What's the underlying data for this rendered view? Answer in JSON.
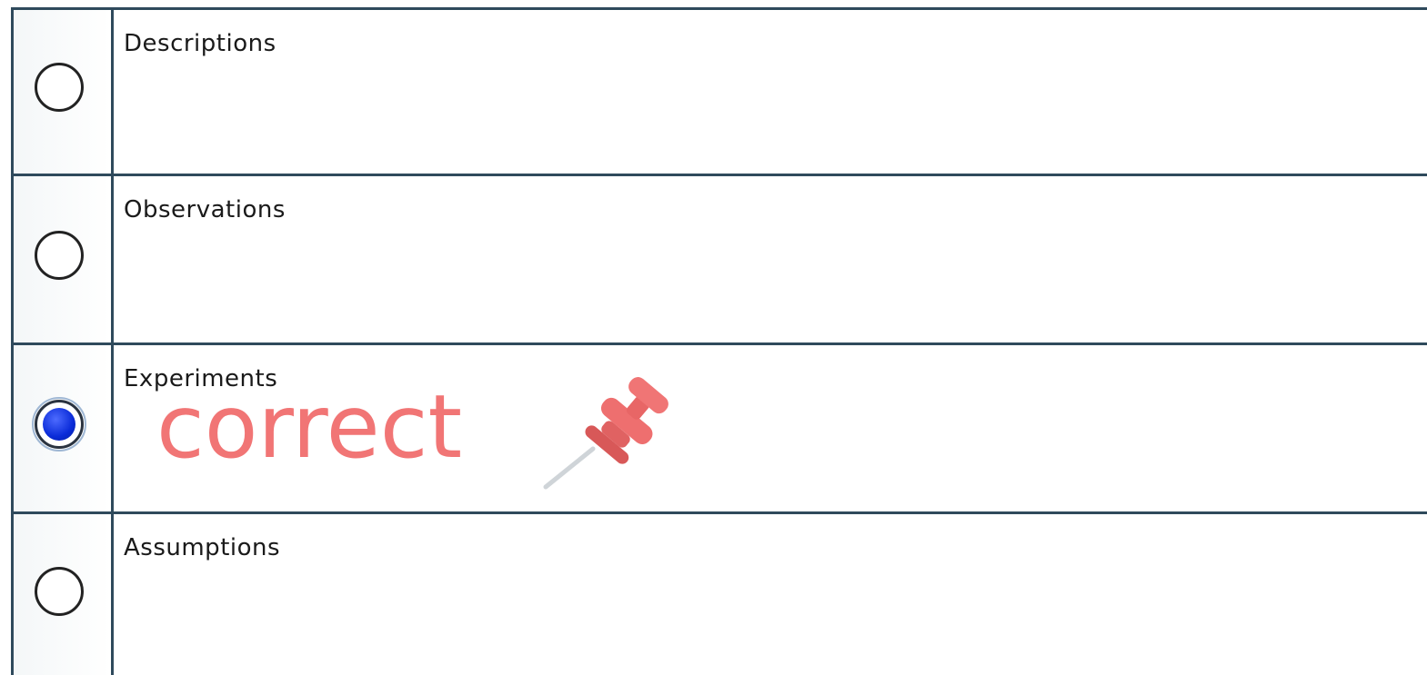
{
  "question": {
    "options": [
      {
        "label": "Descriptions",
        "selected": false
      },
      {
        "label": "Observations",
        "selected": false
      },
      {
        "label": "Experiments",
        "selected": true
      },
      {
        "label": "Assumptions",
        "selected": false
      }
    ]
  },
  "annotation": {
    "text": "correct",
    "icon": "pushpin-icon",
    "color": "#f06a6a"
  },
  "colors": {
    "border": "#2f4a5c",
    "radio_selected": "#0a2bd8"
  }
}
